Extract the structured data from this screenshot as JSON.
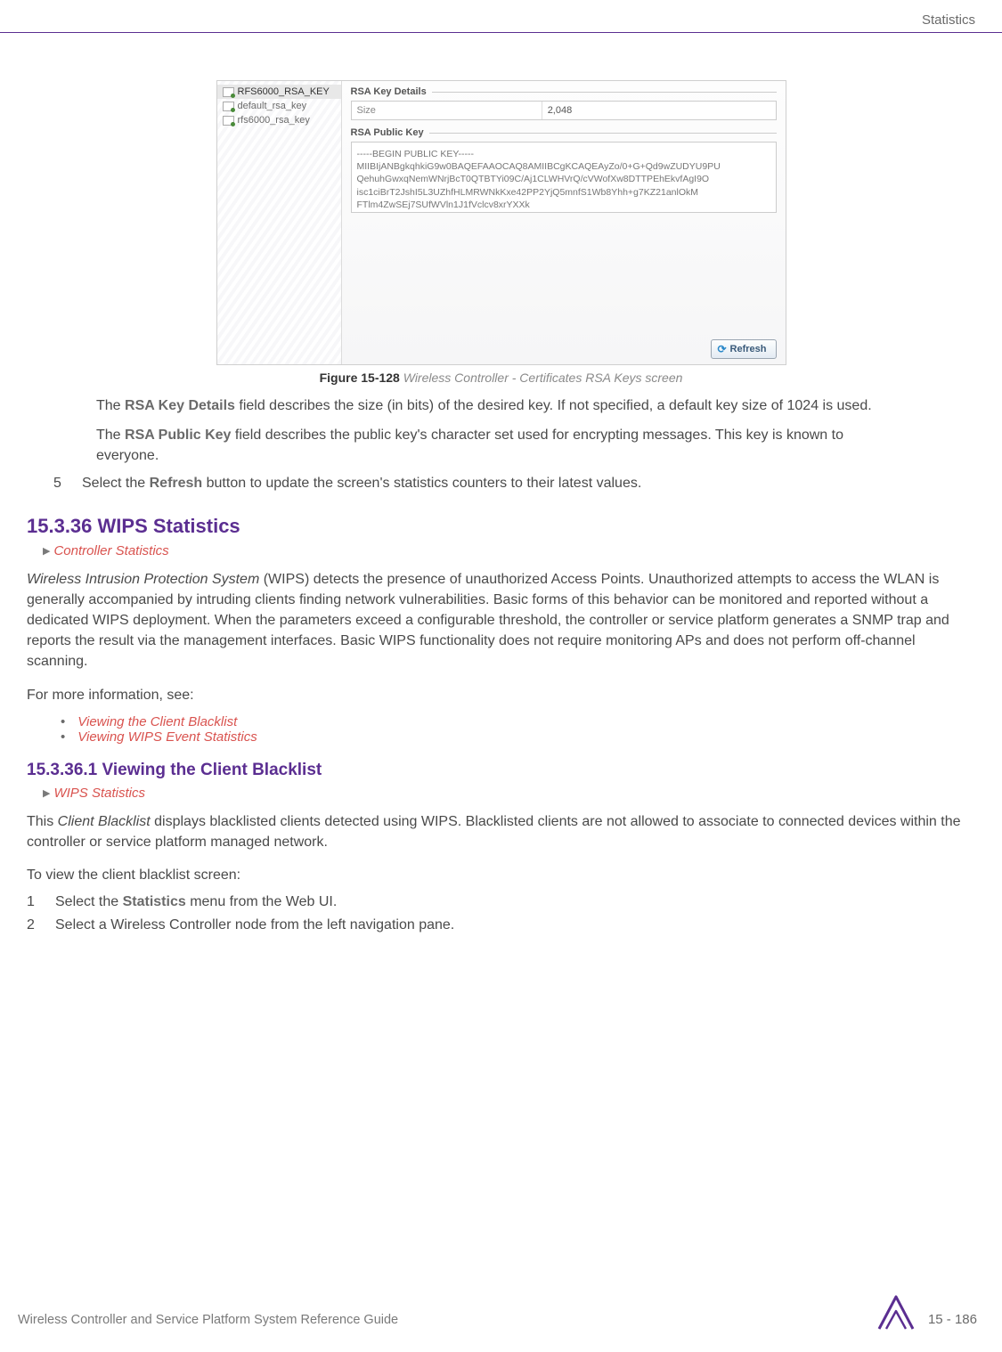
{
  "header": {
    "section": "Statistics"
  },
  "ui": {
    "left_keys": [
      {
        "label": "RFS6000_RSA_KEY",
        "selected": true
      },
      {
        "label": "default_rsa_key",
        "selected": false
      },
      {
        "label": "rfs6000_rsa_key",
        "selected": false
      }
    ],
    "details_title": "RSA Key Details",
    "size_label": "Size",
    "size_value": "2,048",
    "pubkey_title": "RSA Public Key",
    "pubkey_begin": "-----BEGIN PUBLIC KEY-----",
    "pubkey_l1": "MIIBIjANBgkqhkiG9w0BAQEFAAOCAQ8AMIIBCgKCAQEAyZo/0+G+Qd9wZUDYU9PU",
    "pubkey_l2": "QehuhGwxqNemWNrjBcT0QTBTYi09C/Aj1CLWHVrQ/cVWofXw8DTTPEhEkvfAgI9O",
    "pubkey_l3": "isc1ciBrT2JshI5L3UZhfHLMRWNkKxe42PP2YjQ5mnfS1Wb8Yhh+g7KZ21anlOkM",
    "pubkey_l4": "FTlm4ZwSEj7SUfWVln1J1fVclcv8xrYXXk",
    "refresh_label": "Refresh"
  },
  "caption": {
    "fig_label": "Figure 15-128",
    "fig_title": "Wireless Controller - Certificates RSA Keys screen"
  },
  "para": {
    "p1a": "The ",
    "p1b": "RSA Key Details",
    "p1c": " field describes the size (in bits) of the desired key. If not specified, a default key size of 1024 is used.",
    "p2a": "The ",
    "p2b": "RSA Public Key",
    "p2c": " field describes the public key's character set used for encrypting messages. This key is known to everyone.",
    "step5a": "Select the ",
    "step5b": "Refresh",
    "step5c": " button to update the screen's statistics counters to their latest values."
  },
  "sec": {
    "wips_num": "15.3.36  WIPS Statistics",
    "bc_wips": "Controller Statistics",
    "wips_body_ital": "Wireless Intrusion Protection System",
    "wips_body_rest": " (WIPS) detects the presence of unauthorized Access Points. Unauthorized attempts to access the WLAN is generally accompanied by intruding clients finding network vulnerabilities. Basic forms of this behavior can be monitored and reported without a dedicated WIPS deployment. When the parameters exceed a configurable threshold, the controller or service platform generates a SNMP trap and reports the result via the management interfaces. Basic WIPS functionality does not require monitoring APs and does not perform off-channel scanning.",
    "more_info": "For more information, see:",
    "li1": "Viewing the Client Blacklist",
    "li2": "Viewing WIPS Event Statistics",
    "sub_num": "15.3.36.1  Viewing the Client Blacklist",
    "bc_client": "WIPS Statistics",
    "client_p1a": "This ",
    "client_p1b": "Client Blacklist",
    "client_p1c": " displays blacklisted clients detected using WIPS. Blacklisted clients are not allowed to associate to connected devices within the controller or service platform managed network.",
    "client_p2": "To view the client blacklist screen:",
    "cstep1a": "Select the ",
    "cstep1b": "Statistics",
    "cstep1c": " menu from the Web UI.",
    "cstep2": "Select a Wireless Controller node from the left navigation pane."
  },
  "footer": {
    "text": "Wireless Controller and Service Platform System Reference Guide",
    "page": "15 - 186"
  }
}
